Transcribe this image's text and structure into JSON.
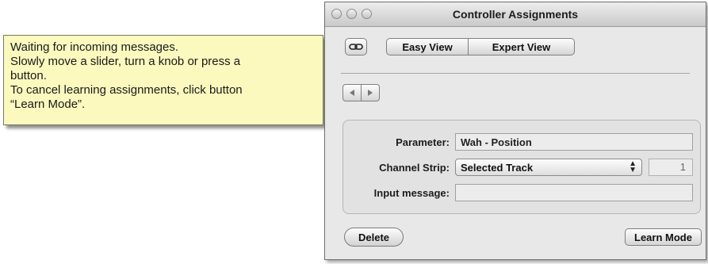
{
  "tooltip": {
    "lines": [
      "Waiting for incoming messages.",
      "Slowly move a slider, turn a knob or press a",
      "button.",
      "To cancel learning assignments, click button",
      "“Learn Mode”."
    ]
  },
  "window": {
    "title": "Controller Assignments",
    "toolbar": {
      "link_icon": "link-icon",
      "easy_view_label": "Easy View",
      "expert_view_label": "Expert View"
    },
    "nav": {
      "back_icon": "arrow-left-icon",
      "forward_icon": "arrow-right-icon"
    },
    "form": {
      "parameter_label": "Parameter:",
      "parameter_value": "Wah - Position",
      "channel_strip_label": "Channel Strip:",
      "channel_strip_value": "Selected Track",
      "channel_strip_number": "1",
      "input_message_label": "Input message:",
      "input_message_value": ""
    },
    "buttons": {
      "delete_label": "Delete",
      "learn_mode_label": "Learn Mode"
    }
  },
  "colors": {
    "tooltip_bg": "#fbf9be",
    "window_bg": "#e8e8e8"
  }
}
